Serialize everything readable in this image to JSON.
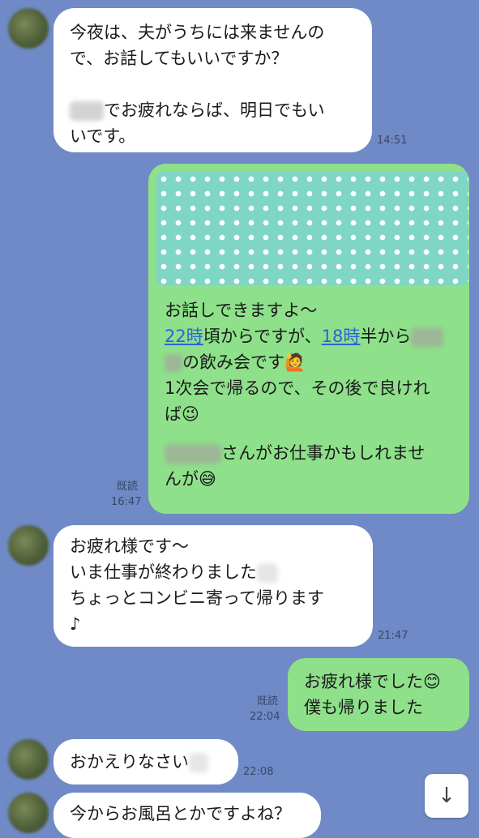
{
  "messages": [
    {
      "side": "left",
      "lines": [
        "今夜は、夫がうちには来ませんの",
        "で、お話してもいいですか？",
        "",
        "でお疲れならば、明日でもい",
        "いです。"
      ],
      "time": "14:51"
    },
    {
      "side": "right",
      "lines": [
        "お話しできますよ～",
        "22時",
        "頃からですが、",
        "18時",
        "半から",
        "の飲み会です🙋",
        "1次会で帰るので、その後で良けれ",
        "ば😉",
        "さんがお仕事かもしれませ",
        "んが😅"
      ],
      "read": "既読",
      "time": "16:47"
    },
    {
      "side": "left",
      "lines": [
        "お疲れ様です～",
        "いま仕事が終わりました",
        "ちょっとコンビニ寄って帰ります",
        "♪"
      ],
      "time": "21:47"
    },
    {
      "side": "right",
      "lines": [
        "お疲れ様でした😊",
        "僕も帰りました"
      ],
      "read": "既読",
      "time": "22:04"
    },
    {
      "side": "left",
      "lines": [
        "おかえりなさい"
      ],
      "time": "22:08"
    },
    {
      "side": "left",
      "lines": [
        "今からお風呂とかですよね？"
      ]
    }
  ],
  "scroll_icon": "arrow-down-icon",
  "scroll_glyph": "↓"
}
